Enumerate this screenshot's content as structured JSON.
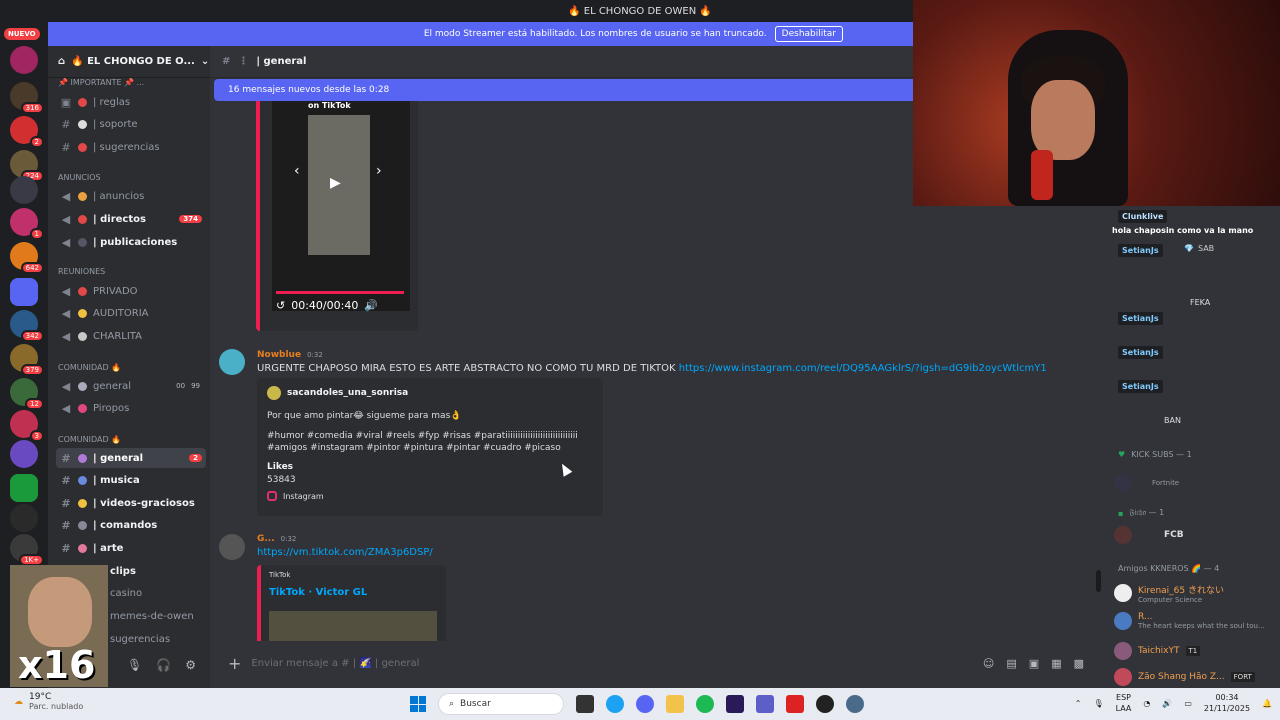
{
  "titlebar": {
    "title": "🔥 EL CHONGO DE OWEN 🔥"
  },
  "streamer_mode": {
    "message": "El modo Streamer está habilitado. Los nombres de usuario se han truncado.",
    "button": "Deshabilitar"
  },
  "rail": {
    "nuevo": "NUEVO",
    "badges": [
      "316",
      "2",
      "224",
      "1",
      "642",
      "342",
      "379",
      "12",
      "3",
      "1K+"
    ]
  },
  "sidebar": {
    "guild_name": "🔥 EL CHONGO DE O...",
    "cat_importante": "📌 Importante 📌 ...",
    "ch_reglas": "| reglas",
    "ch_soporte": "| soporte",
    "ch_sugerencias": "| sugerencias",
    "cat_anuncios": "ANUNCIOS",
    "ch_anuncios": "| anuncios",
    "ch_directos": "| directos",
    "ch_directos_count": "374",
    "ch_publicaciones": "| publicaciones",
    "cat_reuniones": "REUNIONES",
    "ch_privado": "PRIVADO",
    "ch_auditoria": "AUDITORIA",
    "ch_charlita": "CHARLITA",
    "cat_comunidad": "COMUNIDAD 🔥",
    "ch_general_voice": "general",
    "ch_general_voice_a": "00",
    "ch_general_voice_b": "99",
    "ch_piropos": "Piropos",
    "cat_comunidad2": "COMUNIDAD 🔥",
    "ch_general": "| general",
    "ch_general_count": "2",
    "ch_musica": "| musica",
    "ch_videos": "| videos-graciosos",
    "ch_comandos": "| comandos",
    "ch_arte": "| arte",
    "ch_clips": "clips",
    "ch_casino": "casino",
    "ch_memes": "memes-de-owen",
    "ch_sugerencias2": "sugerencias"
  },
  "webcam_small": {
    "overlay": "x16"
  },
  "chat": {
    "channel_name": "| general",
    "new_messages": "16 mensajes nuevos desde las 0:28",
    "tiktok_top_caption": "on TikTok",
    "tiktok_time": "00:40/00:40",
    "msg1_author": "Nowblue",
    "msg1_time": "0:32",
    "msg1_text": "URGENTE CHAPOSO MIRA ESTO ES ARTE ABSTRACTO NO COMO TU MRD DE TIKTOK ",
    "msg1_link": "https://www.instagram.com/reel/DQ95AAGklrS/?igsh=dG9ib2oycWtlcmY1",
    "ig_author": "sacandoles_una_sonrisa",
    "ig_desc": "Por que amo pintar😂 sigueme para mas👌",
    "ig_tags": "#humor #comedia #viral #reels #fyp #risas #paratiiiiiiiiiiiiiiiiiiiiiiiiiiiii #amigos #instagram #pintor #pintura #pintar #cuadro #picaso",
    "ig_likes_label": "Likes",
    "ig_likes_value": "53843",
    "ig_provider": "Instagram",
    "msg2_author": "G...",
    "msg2_time": "0:32",
    "msg2_link": "https://vm.tiktok.com/ZMA3p6DSP/",
    "tt_provider": "TikTok",
    "tt_title": "TikTok · Victor GL",
    "composer_placeholder": "Enviar mensaje a # | 🌠 | general"
  },
  "stream_chat": {
    "line1_user": "Clunklive",
    "line1_text": "hola chaposin como va la mano",
    "tag": "SetianJs",
    "sab": "SAB",
    "feka": "FEKA",
    "ban": "BAN",
    "cat_kick": "KICK SUBS — 1",
    "kick_sub": "Fortnite",
    "cat_ficho": "𝔉𝔦𝔠𝔥𝔬 — 1",
    "fcb": "FCB",
    "cat_amigos": "Amigos KKNEROS 🌈 — 4",
    "m1_name": "Kirenai_65 きれない",
    "m1_sub": "Computer Science",
    "m2_name": "R...",
    "m2_sub": "The heart keeps what the soul tou...",
    "m3_name": "TaichixYT",
    "m3_tag": "T1",
    "m4_name": "Zão Shang Hão Z...",
    "m4_tag": "FORT"
  },
  "taskbar": {
    "temp": "19°C",
    "weather": "Parc. nublado",
    "search": "Buscar",
    "lang1": "ESP",
    "lang2": "LAA",
    "time": "00:34",
    "date": "21/11/2025"
  }
}
